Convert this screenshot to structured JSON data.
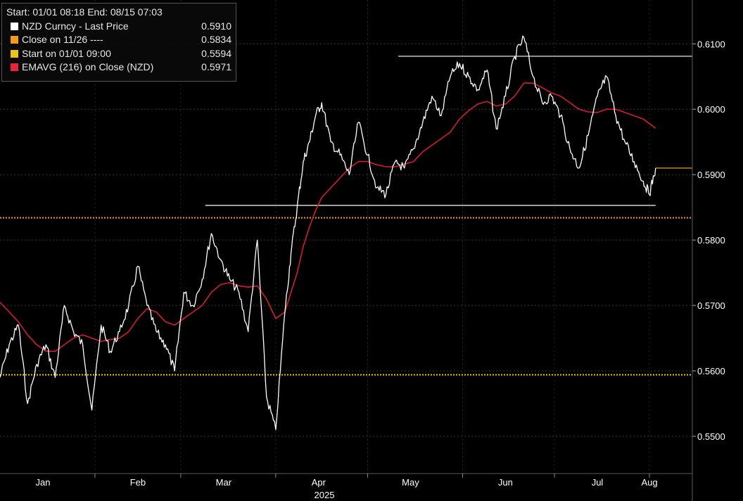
{
  "legend": {
    "header": "Start: 01/01 08:18 End: 08/15 07:03",
    "items": [
      {
        "label": "NZD Curncy - Last Price",
        "value": "0.5910",
        "color": "#ffffff"
      },
      {
        "label": "Close on 11/26 ----",
        "value": "0.5834",
        "color": "#f39a1e"
      },
      {
        "label": "Start on 01/01 09:00",
        "value": "0.5594",
        "color": "#e8c21a"
      },
      {
        "label": "EMAVG (216)  on Close (NZD)",
        "value": "0.5971",
        "color": "#e8243c"
      }
    ]
  },
  "chart_data": {
    "type": "line",
    "year_label": "2025",
    "x_ticks": [
      "Jan",
      "Feb",
      "Mar",
      "Apr",
      "May",
      "Jun",
      "Jul",
      "Aug"
    ],
    "y_ticks": [
      "0.5500",
      "0.5600",
      "0.5700",
      "0.5800",
      "0.5900",
      "0.6000",
      "0.6100"
    ],
    "ylim": [
      0.5443,
      0.6167
    ],
    "x_range": [
      "2025-01-01",
      "2025-08-15"
    ],
    "grid": "horizontal-dotted",
    "colors": {
      "price": "#ffffff",
      "ema": "#d11f2f",
      "close_ref": "#f0a020",
      "start_ref": "#e8c21a",
      "current": "#e0a020",
      "resistance": "#ffffff"
    },
    "series": [
      {
        "name": "NZD Curncy - Last Price",
        "x": [
          "2025-01-01",
          "2025-01-04",
          "2025-01-07",
          "2025-01-10",
          "2025-01-13",
          "2025-01-16",
          "2025-01-19",
          "2025-01-22",
          "2025-01-25",
          "2025-01-28",
          "2025-01-31",
          "2025-02-03",
          "2025-02-06",
          "2025-02-09",
          "2025-02-12",
          "2025-02-15",
          "2025-02-18",
          "2025-02-21",
          "2025-02-24",
          "2025-02-27",
          "2025-03-02",
          "2025-03-05",
          "2025-03-08",
          "2025-03-11",
          "2025-03-14",
          "2025-03-17",
          "2025-03-20",
          "2025-03-23",
          "2025-03-26",
          "2025-03-29",
          "2025-04-01",
          "2025-04-04",
          "2025-04-06",
          "2025-04-08",
          "2025-04-10",
          "2025-04-12",
          "2025-04-14",
          "2025-04-16",
          "2025-04-19",
          "2025-04-22",
          "2025-04-25",
          "2025-04-28",
          "2025-05-01",
          "2025-05-04",
          "2025-05-07",
          "2025-05-10",
          "2025-05-13",
          "2025-05-16",
          "2025-05-19",
          "2025-05-22",
          "2025-05-25",
          "2025-05-28",
          "2025-05-31",
          "2025-06-03",
          "2025-06-06",
          "2025-06-09",
          "2025-06-12",
          "2025-06-15",
          "2025-06-18",
          "2025-06-21",
          "2025-06-24",
          "2025-06-27",
          "2025-06-30",
          "2025-07-03",
          "2025-07-06",
          "2025-07-09",
          "2025-07-12",
          "2025-07-15",
          "2025-07-18",
          "2025-07-21",
          "2025-07-24",
          "2025-07-27",
          "2025-07-30",
          "2025-08-01",
          "2025-08-03"
        ],
        "values": [
          0.559,
          0.564,
          0.567,
          0.555,
          0.561,
          0.564,
          0.559,
          0.57,
          0.566,
          0.564,
          0.554,
          0.567,
          0.563,
          0.566,
          0.57,
          0.576,
          0.57,
          0.566,
          0.564,
          0.56,
          0.572,
          0.57,
          0.574,
          0.581,
          0.577,
          0.574,
          0.572,
          0.566,
          0.58,
          0.556,
          0.551,
          0.569,
          0.578,
          0.585,
          0.592,
          0.595,
          0.599,
          0.601,
          0.595,
          0.593,
          0.59,
          0.598,
          0.593,
          0.588,
          0.587,
          0.592,
          0.591,
          0.594,
          0.598,
          0.602,
          0.599,
          0.605,
          0.607,
          0.605,
          0.603,
          0.606,
          0.597,
          0.602,
          0.608,
          0.611,
          0.605,
          0.601,
          0.602,
          0.599,
          0.594,
          0.591,
          0.596,
          0.602,
          0.605,
          0.599,
          0.595,
          0.592,
          0.589,
          0.587,
          0.591
        ]
      },
      {
        "name": "EMAVG (216)  on Close (NZD)",
        "x": [
          "2025-01-01",
          "2025-01-04",
          "2025-01-07",
          "2025-01-10",
          "2025-01-13",
          "2025-01-16",
          "2025-01-19",
          "2025-01-22",
          "2025-01-25",
          "2025-01-28",
          "2025-01-31",
          "2025-02-03",
          "2025-02-06",
          "2025-02-09",
          "2025-02-12",
          "2025-02-15",
          "2025-02-18",
          "2025-02-21",
          "2025-02-24",
          "2025-02-27",
          "2025-03-02",
          "2025-03-05",
          "2025-03-08",
          "2025-03-11",
          "2025-03-14",
          "2025-03-17",
          "2025-03-20",
          "2025-03-23",
          "2025-03-26",
          "2025-03-29",
          "2025-04-01",
          "2025-04-04",
          "2025-04-06",
          "2025-04-08",
          "2025-04-10",
          "2025-04-12",
          "2025-04-14",
          "2025-04-16",
          "2025-04-19",
          "2025-04-22",
          "2025-04-25",
          "2025-04-28",
          "2025-05-01",
          "2025-05-04",
          "2025-05-07",
          "2025-05-10",
          "2025-05-13",
          "2025-05-16",
          "2025-05-19",
          "2025-05-22",
          "2025-05-25",
          "2025-05-28",
          "2025-05-31",
          "2025-06-03",
          "2025-06-06",
          "2025-06-09",
          "2025-06-12",
          "2025-06-15",
          "2025-06-18",
          "2025-06-21",
          "2025-06-24",
          "2025-06-27",
          "2025-06-30",
          "2025-07-03",
          "2025-07-06",
          "2025-07-09",
          "2025-07-12",
          "2025-07-15",
          "2025-07-18",
          "2025-07-21",
          "2025-07-24",
          "2025-07-27",
          "2025-07-30",
          "2025-08-01",
          "2025-08-03"
        ],
        "values": [
          0.5705,
          0.569,
          0.5675,
          0.5655,
          0.564,
          0.563,
          0.563,
          0.564,
          0.565,
          0.5655,
          0.565,
          0.5645,
          0.5648,
          0.565,
          0.566,
          0.568,
          0.5695,
          0.569,
          0.5675,
          0.567,
          0.568,
          0.569,
          0.57,
          0.572,
          0.5732,
          0.5735,
          0.573,
          0.5728,
          0.573,
          0.571,
          0.568,
          0.569,
          0.572,
          0.575,
          0.579,
          0.582,
          0.5845,
          0.5865,
          0.588,
          0.5895,
          0.591,
          0.592,
          0.592,
          0.5915,
          0.5912,
          0.5912,
          0.5916,
          0.592,
          0.5935,
          0.5945,
          0.5955,
          0.5965,
          0.5985,
          0.5998,
          0.6008,
          0.6012,
          0.6005,
          0.6008,
          0.602,
          0.604,
          0.604,
          0.6033,
          0.6025,
          0.602,
          0.601,
          0.6,
          0.5996,
          0.5995,
          0.6,
          0.6,
          0.5995,
          0.599,
          0.5985,
          0.5978,
          0.5971
        ]
      }
    ],
    "annotations": [
      {
        "type": "hline",
        "label": "Close on 11/26",
        "y": 0.5834,
        "style": "dotted",
        "x_start": "2025-01-01",
        "x_end": "2025-08-15"
      },
      {
        "type": "hline",
        "label": "Start on 01/01 09:00",
        "y": 0.5594,
        "style": "dotted",
        "x_start": "2025-01-01",
        "x_end": "2025-08-15"
      },
      {
        "type": "hline",
        "label": "current",
        "y": 0.591,
        "style": "solid",
        "x_start": "2025-08-03",
        "x_end": "2025-08-15"
      },
      {
        "type": "hline",
        "label": "support",
        "y": 0.5853,
        "style": "solid",
        "x_start": "2025-03-09",
        "x_end": "2025-08-03"
      },
      {
        "type": "hline",
        "label": "resistance",
        "y": 0.6081,
        "style": "solid",
        "x_start": "2025-05-11",
        "x_end": "2025-08-15"
      }
    ]
  }
}
